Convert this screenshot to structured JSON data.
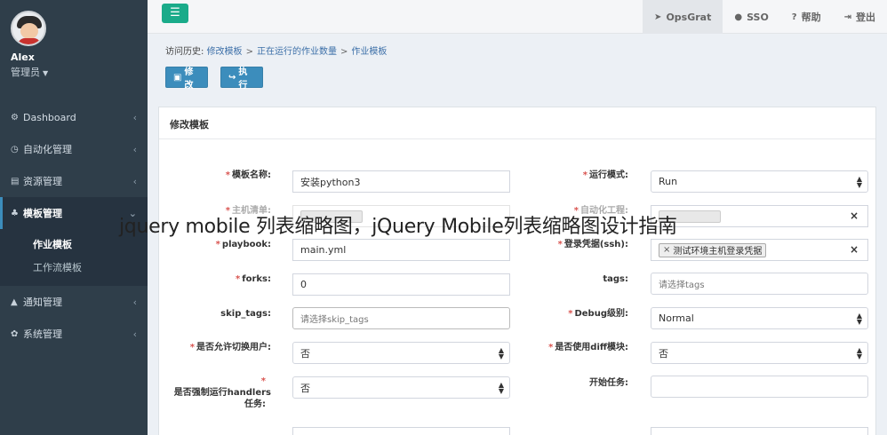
{
  "user": {
    "name": "Alex",
    "role": "管理员"
  },
  "sidebar": {
    "items": [
      {
        "label": "Dashboard"
      },
      {
        "label": "自动化管理"
      },
      {
        "label": "资源管理"
      },
      {
        "label": "模板管理"
      },
      {
        "label": "通知管理"
      },
      {
        "label": "系统管理"
      }
    ],
    "submenu": [
      {
        "label": "作业模板"
      },
      {
        "label": "工作流模板"
      }
    ]
  },
  "topnav": {
    "items": [
      {
        "label": "OpsGrat"
      },
      {
        "label": "SSO"
      },
      {
        "label": "帮助"
      },
      {
        "label": "登出"
      }
    ]
  },
  "breadcrumb": {
    "prefix": "访问历史:",
    "items": [
      "修改模板",
      "正在运行的作业数量",
      "作业模板"
    ],
    "sep": ">"
  },
  "toolbar": {
    "edit_label": "修改",
    "run_label": "执行"
  },
  "panel": {
    "title": "修改模板"
  },
  "form": {
    "template_name": {
      "label": "模板名称:",
      "value": "安装python3"
    },
    "run_mode": {
      "label": "运行模式:",
      "value": "Run"
    },
    "host_list": {
      "label": "主机清单:"
    },
    "auto_project": {
      "label": "自动化工程:"
    },
    "playbook": {
      "label": "playbook:",
      "value": "main.yml"
    },
    "login_cred": {
      "label": "登录凭据(ssh):",
      "tag": "测试环境主机登录凭据"
    },
    "forks": {
      "label": "forks:",
      "value": "0"
    },
    "tags": {
      "label": "tags:",
      "placeholder": "请选择tags"
    },
    "skip_tags": {
      "label": "skip_tags:",
      "placeholder": "请选择skip_tags"
    },
    "debug_level": {
      "label": "Debug级别:",
      "value": "Normal"
    },
    "allow_switch_user": {
      "label": "是否允许切换用户:",
      "value": "否"
    },
    "use_diff": {
      "label": "是否使用diff模块:",
      "value": "否"
    },
    "force_handlers": {
      "label_line1": "是否强制运行handlers",
      "label_line2": "任务:",
      "value": "否"
    },
    "start_task": {
      "label": "开始任务:"
    }
  },
  "watermark": "jquery mobile 列表缩略图，jQuery Mobile列表缩略图设计指南"
}
